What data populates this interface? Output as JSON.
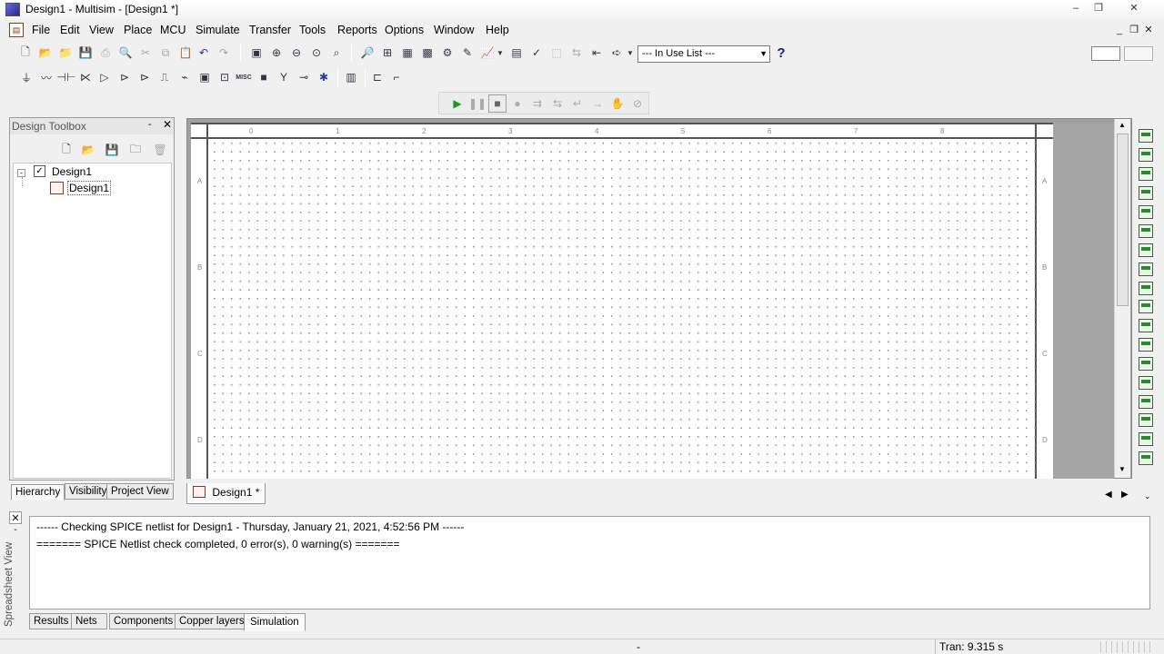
{
  "window": {
    "title": "Design1 - Multisim - [Design1 *]",
    "controls": [
      "–",
      "❐",
      "✕"
    ]
  },
  "menubar": {
    "items": [
      "File",
      "Edit",
      "View",
      "Place",
      "MCU",
      "Simulate",
      "Transfer",
      "Tools",
      "Reports",
      "Options",
      "Window",
      "Help"
    ],
    "mdi_controls": [
      "_",
      "❐",
      "✕"
    ]
  },
  "toolbar": {
    "in_use_list": "--- In Use List ---",
    "help": "?"
  },
  "component_toolbar": {
    "misc_label": "MISC"
  },
  "toolbox": {
    "title": "Design Toolbox",
    "tree": {
      "root": "Design1",
      "child": "Design1"
    },
    "tabs": [
      "Hierarchy",
      "Visibility",
      "Project View"
    ]
  },
  "canvas": {
    "ruler_top": [
      "0",
      "1",
      "2",
      "3",
      "4",
      "5",
      "6",
      "7",
      "8"
    ],
    "ruler_left": [
      "A",
      "B",
      "C",
      "D"
    ],
    "tab_label": "Design1 *"
  },
  "spreadsheet": {
    "side_label": "Spreadsheet View",
    "lines": [
      "------ Checking SPICE netlist for Design1 - Thursday, January 21, 2021, 4:52:56 PM ------",
      "======= SPICE Netlist check completed, 0 error(s), 0 warning(s) ======="
    ],
    "tabs": [
      "Results",
      "Nets",
      "Components",
      "Copper layers",
      "Simulation"
    ],
    "active_tab": "Simulation"
  },
  "status": {
    "middle": "-",
    "tran": "Tran: 9.315 s"
  }
}
